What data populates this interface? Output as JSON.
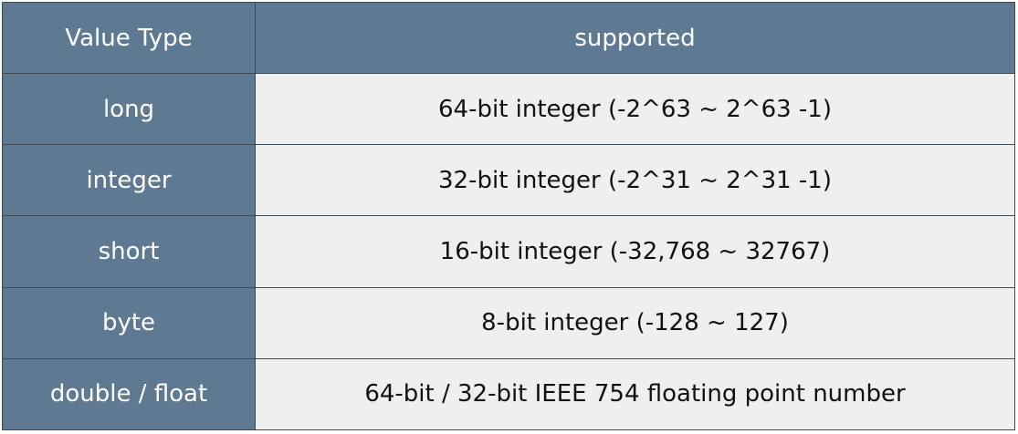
{
  "header": {
    "type_label": "Value Type",
    "supported_label": "supported"
  },
  "rows": [
    {
      "type": "long",
      "supported": "64-bit integer (-2^63 ~ 2^63 -1)"
    },
    {
      "type": "integer",
      "supported": "32-bit integer (-2^31 ~ 2^31 -1)"
    },
    {
      "type": "short",
      "supported": "16-bit integer (-32,768 ~ 32767)"
    },
    {
      "type": "byte",
      "supported": "8-bit integer (-128 ~ 127)"
    },
    {
      "type": "double / float",
      "supported": "64-bit / 32-bit IEEE 754 floating point number"
    }
  ],
  "colors": {
    "header_bg": "#5f7993",
    "cell_bg": "#efefef",
    "border": "#3f4a55"
  }
}
